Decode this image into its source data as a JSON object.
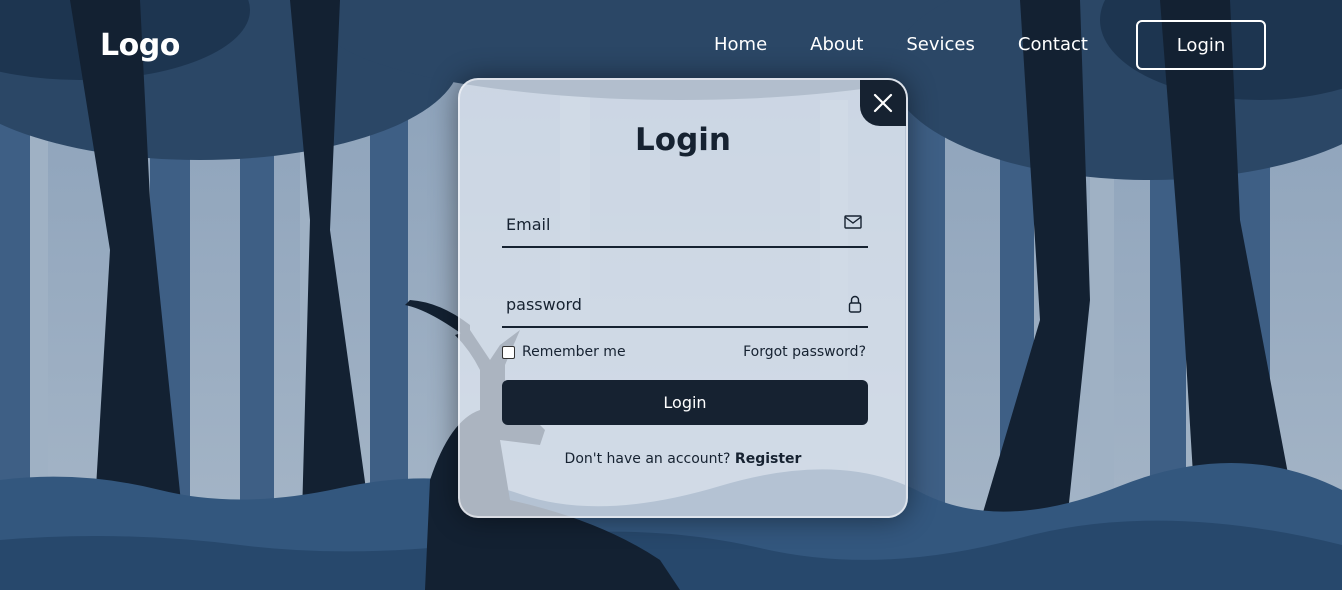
{
  "header": {
    "logo": "Logo",
    "nav": [
      "Home",
      "About",
      "Sevices",
      "Contact"
    ],
    "login_button": "Login"
  },
  "modal": {
    "title": "Login",
    "email_placeholder": "Email",
    "email_icon": "mail-icon",
    "password_placeholder": "password",
    "password_icon": "lock-icon",
    "close_icon": "close-icon",
    "remember_label": "Remember me",
    "forgot_label": "Forgot password?",
    "submit_label": "Login",
    "register_prompt": "Don't have an account?",
    "register_link": "Register"
  },
  "colors": {
    "primary": "#162231",
    "background": "#6d87a3",
    "text_light": "#ffffff"
  }
}
